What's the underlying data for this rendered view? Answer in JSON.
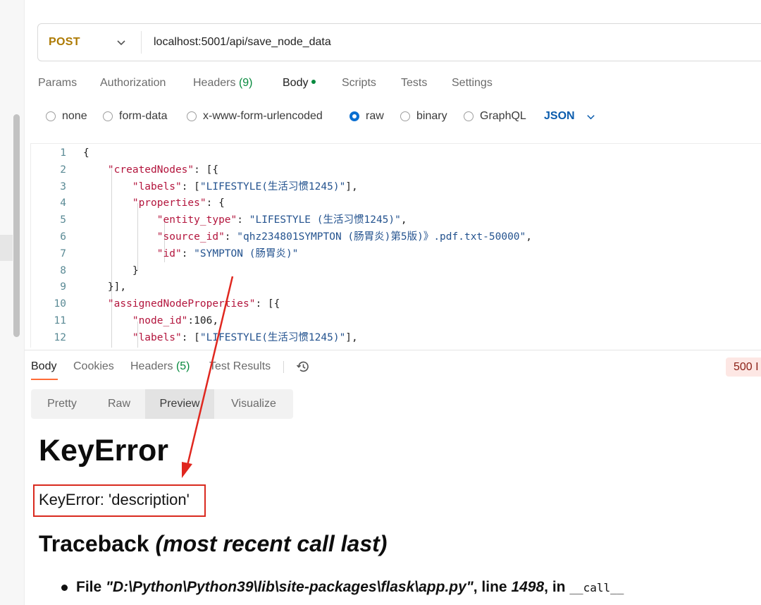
{
  "request": {
    "method": "POST",
    "url": "localhost:5001/api/save_node_data"
  },
  "request_tabs": {
    "params": "Params",
    "authorization": "Authorization",
    "headers": "Headers",
    "headers_count": "(9)",
    "body": "Body",
    "scripts": "Scripts",
    "tests": "Tests",
    "settings": "Settings"
  },
  "body_types": {
    "none": "none",
    "form_data": "form-data",
    "urlencoded": "x-www-form-urlencoded",
    "raw": "raw",
    "binary": "binary",
    "graphql": "GraphQL",
    "selected": "raw",
    "format": "JSON"
  },
  "editor": {
    "lines": [
      {
        "n": "1",
        "parts": [
          {
            "t": "{",
            "c": "p"
          }
        ]
      },
      {
        "n": "2",
        "parts": [
          {
            "t": "    ",
            "c": "p"
          },
          {
            "t": "\"createdNodes\"",
            "c": "k"
          },
          {
            "t": ": [{",
            "c": "p"
          }
        ]
      },
      {
        "n": "3",
        "parts": [
          {
            "t": "        ",
            "c": "p"
          },
          {
            "t": "\"labels\"",
            "c": "k"
          },
          {
            "t": ": [",
            "c": "p"
          },
          {
            "t": "\"LIFESTYLE(生活习惯1245)\"",
            "c": "s"
          },
          {
            "t": "],",
            "c": "p"
          }
        ]
      },
      {
        "n": "4",
        "parts": [
          {
            "t": "        ",
            "c": "p"
          },
          {
            "t": "\"properties\"",
            "c": "k"
          },
          {
            "t": ": {",
            "c": "p"
          }
        ]
      },
      {
        "n": "5",
        "parts": [
          {
            "t": "            ",
            "c": "p"
          },
          {
            "t": "\"entity_type\"",
            "c": "k"
          },
          {
            "t": ": ",
            "c": "p"
          },
          {
            "t": "\"LIFESTYLE (生活习惯1245)\"",
            "c": "s"
          },
          {
            "t": ",",
            "c": "p"
          }
        ]
      },
      {
        "n": "6",
        "parts": [
          {
            "t": "            ",
            "c": "p"
          },
          {
            "t": "\"source_id\"",
            "c": "k"
          },
          {
            "t": ": ",
            "c": "p"
          },
          {
            "t": "\"qhz234801SYMPTON (肠胃炎)第5版)》.pdf.txt-50000\"",
            "c": "s"
          },
          {
            "t": ",",
            "c": "p"
          }
        ]
      },
      {
        "n": "7",
        "parts": [
          {
            "t": "            ",
            "c": "p"
          },
          {
            "t": "\"id\"",
            "c": "k"
          },
          {
            "t": ": ",
            "c": "p"
          },
          {
            "t": "\"SYMPTON (肠胃炎)\"",
            "c": "s"
          }
        ]
      },
      {
        "n": "8",
        "parts": [
          {
            "t": "        }",
            "c": "p"
          }
        ]
      },
      {
        "n": "9",
        "parts": [
          {
            "t": "    }],",
            "c": "p"
          }
        ]
      },
      {
        "n": "10",
        "parts": [
          {
            "t": "    ",
            "c": "p"
          },
          {
            "t": "\"assignedNodeProperties\"",
            "c": "k"
          },
          {
            "t": ": [{",
            "c": "p"
          }
        ]
      },
      {
        "n": "11",
        "parts": [
          {
            "t": "        ",
            "c": "p"
          },
          {
            "t": "\"node_id\"",
            "c": "k"
          },
          {
            "t": ":106,",
            "c": "p"
          }
        ]
      },
      {
        "n": "12",
        "parts": [
          {
            "t": "        ",
            "c": "p"
          },
          {
            "t": "\"labels\"",
            "c": "k"
          },
          {
            "t": ": [",
            "c": "p"
          },
          {
            "t": "\"LIFESTYLE(生活习惯1245)\"",
            "c": "s"
          },
          {
            "t": "],",
            "c": "p"
          }
        ]
      }
    ]
  },
  "response_tabs": {
    "body": "Body",
    "cookies": "Cookies",
    "headers": "Headers",
    "headers_count": "(5)",
    "test_results": "Test Results",
    "status": "500 I"
  },
  "view_modes": {
    "pretty": "Pretty",
    "raw": "Raw",
    "preview": "Preview",
    "visualize": "Visualize",
    "selected": "Preview"
  },
  "preview": {
    "error_title": "KeyError",
    "error_message": "KeyError: 'description'",
    "traceback_title": "Traceback",
    "traceback_note": "(most recent call last)",
    "trace": {
      "file_label": "File",
      "path": "\"D:\\Python\\Python39\\lib\\site-packages\\flask\\app.py\"",
      "line_label": ", line",
      "line_no": "1498",
      "in_label": ", in",
      "func": "__call__"
    }
  },
  "colors": {
    "method": "#ad7a03",
    "accent_orange": "#ff6c37",
    "success_green": "#078a3e",
    "radio_blue": "#0b6fd1",
    "annotation_red": "#d92a1f",
    "json_key": "#b3153d",
    "json_string": "#24538f"
  }
}
